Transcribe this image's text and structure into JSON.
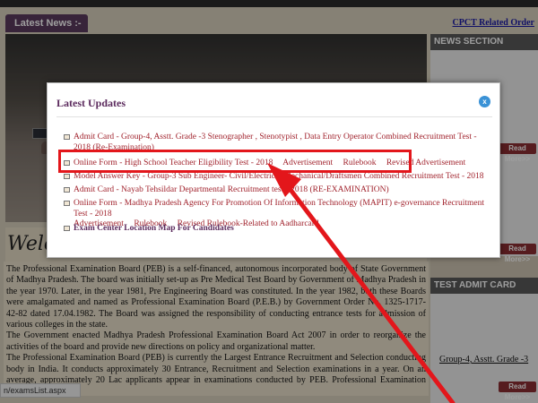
{
  "header": {
    "latest_news_tab": "Latest News :-",
    "cpct_link": "CPCT Related Order"
  },
  "sidebar": {
    "news_section": "NEWS SECTION",
    "read_more": "Read More>>",
    "test_admit_card": "TEST ADMIT CARD",
    "admit_item": "Group-4, Asstt. Grade -3"
  },
  "main": {
    "welcome": "Welco",
    "paragraphs": [
      "The Professional Examination Board (PEB) is a self-financed, autonomous incorporated body of State Government of Madhya Pradesh. The board was initially set-up as Pre Medical Test Board by Government of Madhya Pradesh in the year 1970. Later, in the year 1981, Pre Engineering Board was constituted. In the year 1982, both these Boards were amalgamated and named as Professional Examination Board (P.E.B.) by Government Order No. 1325-1717-42-82 dated 17.04.1982. The Board was assigned the responsibility of conducting entrance tests for admission of various colleges in the state.",
      "The Government enacted Madhya Pradesh Professional Examination Board Act 2007 in order to reorganize the activities of the board and provide new directions on policy and organizational matter.",
      "The Professional Examination Board (PEB) is currently the Largest Entrance Recruitment and Selection conducting body in India. It conducts approximately 30 Entrance, Recruitment and Selection examinations in a year. On an average, approximately 20 Lac applicants appear in examinations conducted by PEB. Professional Examination Board is"
    ]
  },
  "status_bar": {
    "url": "n/examsList.aspx"
  },
  "modal": {
    "title": "Latest Updates",
    "close_label": "x",
    "updates": [
      {
        "parts": [
          "Admit Card - Group-4, Asstt. Grade -3 Stenographer , Stenotypist , Data Entry Operator Combined Recruitment Test - 2018 (Re-Examination)"
        ]
      },
      {
        "parts": [
          "Online Form - High School Teacher Eligibility Test - 2018",
          "Advertisement",
          "Rulebook",
          "Revised Advertisement"
        ]
      },
      {
        "parts": [
          "Model Answer Key - Group-3 Sub Engineer- Civil/Electrical/Mechanical/Draftsmen Combined Recruitment Test - 2018"
        ]
      },
      {
        "parts": [
          "Admit Card - Nayab Tehsildar Departmental Recruitment test - 2018 (RE-EXAMINATION)"
        ]
      },
      {
        "parts": [
          "Online Form - Madhya Pradesh Agency For Promotion Of Information Technology (MAPIT) e-governance Recruitment Test - 2018",
          "Advertisement",
          "Rulebook",
          "Revised Rulebook-Related to Aadharcard"
        ]
      },
      {
        "parts": [
          "Exam Center Location Map For Candidates"
        ]
      }
    ]
  },
  "colors": {
    "accent_purple": "#5b2a5d",
    "link_red": "#a1232d",
    "highlight_red": "#e3161b",
    "close_blue": "#3a92d6"
  }
}
